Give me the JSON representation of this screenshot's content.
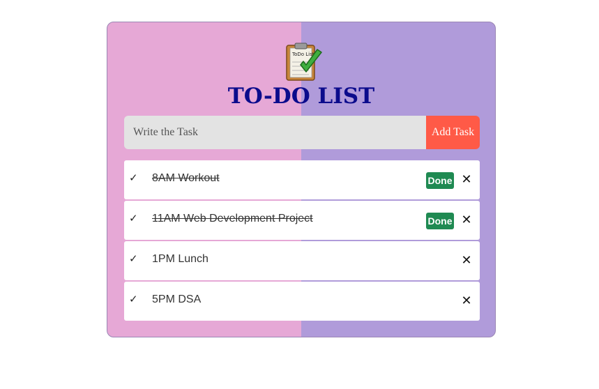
{
  "header": {
    "logo_icon": "todo-clipboard-icon",
    "logo_text": "ToDo List",
    "title": "TO-DO LIST"
  },
  "input": {
    "placeholder": "Write the Task",
    "value": "",
    "add_label": "Add Task"
  },
  "colors": {
    "left_bg": "#e6a8d6",
    "right_bg": "#b09bda",
    "title": "#0b0b8c",
    "add_button": "#ff5a47",
    "done_badge": "#1f8a52"
  },
  "tasks": [
    {
      "check": "✓",
      "text": "8AM Workout",
      "done": true,
      "done_label": "Done",
      "close": "✕"
    },
    {
      "check": "✓",
      "text": "11AM Web Development Project",
      "done": true,
      "done_label": "Done",
      "close": "✕"
    },
    {
      "check": "✓",
      "text": "1PM Lunch",
      "done": false,
      "close": "✕"
    },
    {
      "check": "✓",
      "text": "5PM DSA",
      "done": false,
      "close": "✕"
    }
  ]
}
